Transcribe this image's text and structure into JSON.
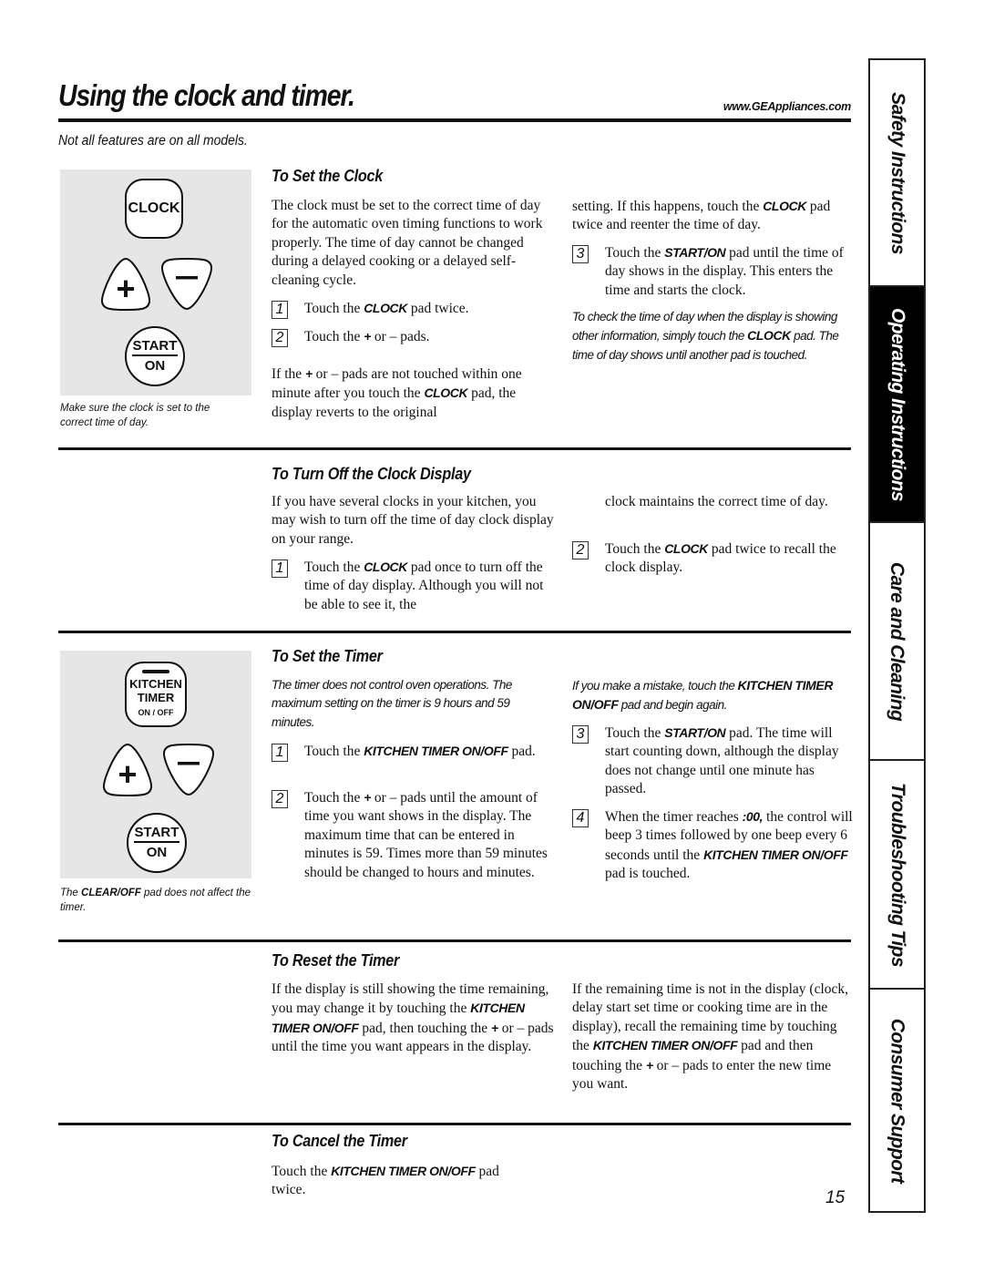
{
  "header": {
    "title": "Using the clock and timer.",
    "url": "www.GEAppliances.com",
    "subtitle": "Not all features are on all models."
  },
  "clock_panel": {
    "clock_pad": "CLOCK",
    "plus_pad": "+",
    "minus_pad": "–",
    "start_pad_top": "START",
    "start_pad_bottom": "ON",
    "caption": "Make sure the clock is set to the correct time of day."
  },
  "timer_panel": {
    "timer_pad_line1": "KITCHEN",
    "timer_pad_line2": "TIMER",
    "timer_pad_line3": "ON / OFF",
    "plus_pad": "+",
    "minus_pad": "–",
    "start_pad_top": "START",
    "start_pad_bottom": "ON",
    "caption_kw": "CLEAR/OFF",
    "caption_pre": "The ",
    "caption_post": " pad does not affect the timer."
  },
  "set_clock": {
    "heading": "To Set the Clock",
    "intro": "The clock must be set to the correct time of day for the automatic oven timing functions to work properly. The time of day cannot be changed during a delayed cooking or a delayed self-cleaning cycle.",
    "steps": [
      {
        "num": "1",
        "pre": "Touch the ",
        "kw": "CLOCK",
        "post": " pad twice."
      },
      {
        "num": "2",
        "pre": "Touch the ",
        "kw": "+",
        "post": " or – pads."
      },
      {
        "num": "3",
        "pre": "Touch the ",
        "kw": "START/ON",
        "post": " pad until the time of day shows in the display. This enters the time and starts the clock."
      }
    ],
    "para_pre": "If the ",
    "para_kw1": "+",
    "para_mid": " or – pads are not touched within one minute after you touch the ",
    "para_kw2": "CLOCK",
    "para_post": " pad, the display reverts to the original",
    "cont_pre": "setting. If this happens, touch the ",
    "cont_kw": "CLOCK",
    "cont_post": " pad twice and reenter the time of day.",
    "note_pre": "To check the time of day when the display is showing other information, simply touch the ",
    "note_kw": "CLOCK",
    "note_post": " pad. The time of day shows until another pad is touched."
  },
  "turn_off_clock": {
    "heading": "To Turn Off the Clock Display",
    "intro": "If you have several clocks in your kitchen, you may wish to turn off the time of day clock display on your range.",
    "steps": [
      {
        "num": "1",
        "pre": "Touch the ",
        "kw": "CLOCK",
        "post": " pad once to turn off the time of day display. Although you will not be able to see it, the"
      },
      {
        "num": "2",
        "pre": "Touch the ",
        "kw": "CLOCK",
        "post": " pad twice to recall the clock display."
      }
    ],
    "cont": "clock maintains the correct time of day."
  },
  "set_timer": {
    "heading": "To Set the Timer",
    "note": "The timer does not control oven operations. The maximum setting on the timer is 9 hours and 59 minutes.",
    "mistake_pre": "If you make a mistake, touch the ",
    "mistake_kw": "KITCHEN TIMER ON/OFF",
    "mistake_post": " pad and begin again.",
    "steps": [
      {
        "num": "1",
        "pre": "Touch the ",
        "kw": "KITCHEN TIMER ON/OFF",
        "post": " pad."
      },
      {
        "num": "2",
        "pre": "Touch the ",
        "kw": "+",
        "post": " or – pads until the amount of time you want shows in the display. The maximum time that can be entered in minutes is 59. Times more than 59 minutes should be changed to hours and minutes."
      },
      {
        "num": "3",
        "pre": "Touch the ",
        "kw": "START/ON",
        "post": " pad. The time will start counting down, although the display does not change until one minute has passed."
      },
      {
        "num": "4",
        "pre": "When the timer reaches ",
        "kw": ":00,",
        "mid": " the control will beep 3 times followed by one beep every 6 seconds until the ",
        "kw2": "KITCHEN TIMER ON/OFF",
        "post": " pad is touched."
      }
    ]
  },
  "reset_timer": {
    "heading": "To Reset the Timer",
    "left_pre": "If the display is still showing the time remaining, you may change it by touching the ",
    "left_kw1": "KITCHEN TIMER ON/OFF",
    "left_mid": " pad, then touching the ",
    "left_kw2": "+",
    "left_post": " or – pads until the time you want appears in the display.",
    "right_pre": "If the remaining time is not in the display (clock, delay start set time or cooking time are in the display), recall the remaining time by touching the ",
    "right_kw1": "KITCHEN TIMER ON/OFF",
    "right_mid": " pad and then touching the ",
    "right_kw2": "+",
    "right_post": " or – pads to enter the new time you want."
  },
  "cancel_timer": {
    "heading": "To Cancel the Timer",
    "pre": "Touch the ",
    "kw": "KITCHEN TIMER ON/OFF",
    "post": " pad twice."
  },
  "side_tabs": [
    {
      "label": "Safety Instructions",
      "active": false
    },
    {
      "label": "Operating Instructions",
      "active": true
    },
    {
      "label": "Care and Cleaning",
      "active": false
    },
    {
      "label": "Troubleshooting Tips",
      "active": false
    },
    {
      "label": "Consumer Support",
      "active": false
    }
  ],
  "page_number": "15"
}
